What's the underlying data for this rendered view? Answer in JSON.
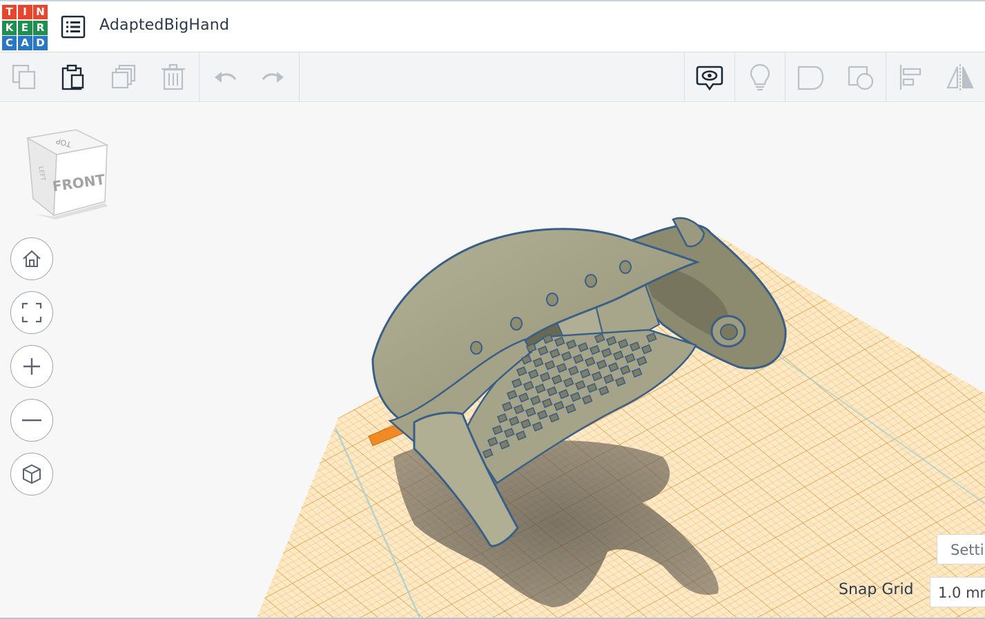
{
  "app": {
    "logo_letters": [
      "T",
      "I",
      "N",
      "K",
      "E",
      "R",
      "C",
      "A",
      "D"
    ],
    "logo_colors": [
      "#e8452c",
      "#e8452c",
      "#e8452c",
      "#1e8f4e",
      "#1e8f4e",
      "#1e8f4e",
      "#2a78c4",
      "#2a78c4",
      "#2a78c4"
    ],
    "design_title": "AdaptedBigHand",
    "menu_icon": "list-icon"
  },
  "toolbar": {
    "left_tools": [
      {
        "name": "copy-button",
        "icon": "copy-icon",
        "enabled": false
      },
      {
        "name": "paste-button",
        "icon": "clipboard-icon",
        "enabled": true
      },
      {
        "name": "duplicate-button",
        "icon": "duplicate-icon",
        "enabled": false
      },
      {
        "name": "delete-button",
        "icon": "trash-icon",
        "enabled": false
      },
      {
        "name": "undo-button",
        "icon": "undo-icon",
        "enabled": false
      },
      {
        "name": "redo-button",
        "icon": "redo-icon",
        "enabled": false
      }
    ],
    "right_tools": [
      {
        "name": "notes-button",
        "icon": "speech-eye-icon",
        "enabled": true
      },
      {
        "name": "show-all-button",
        "icon": "lightbulb-icon",
        "enabled": false
      },
      {
        "name": "group-button",
        "icon": "group-icon",
        "enabled": false
      },
      {
        "name": "ungroup-button",
        "icon": "ungroup-icon",
        "enabled": false
      },
      {
        "name": "align-button",
        "icon": "align-icon",
        "enabled": false
      },
      {
        "name": "mirror-button",
        "icon": "mirror-icon",
        "enabled": false
      }
    ]
  },
  "view_cube": {
    "top_face": "TOP",
    "front_face": "FRONT",
    "left_face": "LEFT"
  },
  "nav_controls": [
    {
      "name": "home-view-button",
      "icon": "home-icon"
    },
    {
      "name": "fit-view-button",
      "icon": "fit-icon"
    },
    {
      "name": "zoom-in-button",
      "icon": "plus-icon"
    },
    {
      "name": "zoom-out-button",
      "icon": "minus-icon"
    },
    {
      "name": "ortho-view-button",
      "icon": "cube-icon"
    }
  ],
  "workplane": {
    "grid_color": "#f2a23a",
    "object_color": "#a19f82",
    "object_outline": "#3a5f87"
  },
  "footer": {
    "settings_label": "Setti",
    "snap_grid_label": "Snap Grid",
    "snap_grid_value": "1.0 mr"
  },
  "colors": {
    "toolbar_bg": "#f3f4f5",
    "icon_disabled": "#b9c0c7",
    "icon_enabled": "#2c3e50"
  }
}
